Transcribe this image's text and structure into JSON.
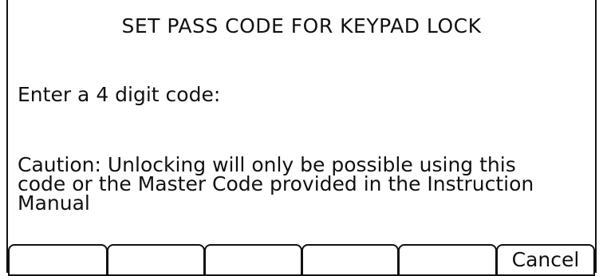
{
  "dialog": {
    "title": "SET PASS CODE FOR KEYPAD LOCK",
    "prompt": "Enter a 4 digit code:",
    "caution": "Caution: Unlocking will only be possible using this\ncode or the Master Code provided in the Instruction\nManual"
  },
  "softkeys": [
    {
      "label": ""
    },
    {
      "label": ""
    },
    {
      "label": ""
    },
    {
      "label": ""
    },
    {
      "label": ""
    },
    {
      "label": "Cancel"
    }
  ]
}
